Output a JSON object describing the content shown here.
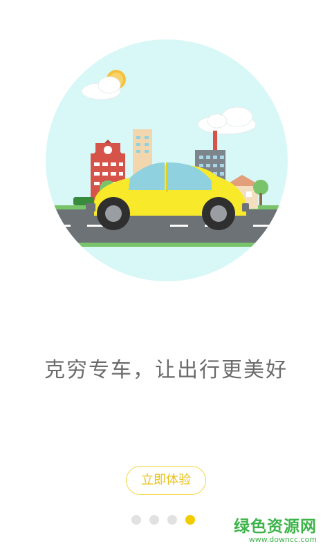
{
  "slogan": "克穷专车，让出行更美好",
  "cta": {
    "label": "立即体验"
  },
  "pagination": {
    "count": 4,
    "active_index": 3
  },
  "watermark": {
    "name": "绿色资源网",
    "url": "www.downcc.com"
  },
  "colors": {
    "accent_yellow": "#f2cb00",
    "sky": "#d8f7f7",
    "car": "#f8ea2a",
    "watermark_green": "#3db34a"
  }
}
